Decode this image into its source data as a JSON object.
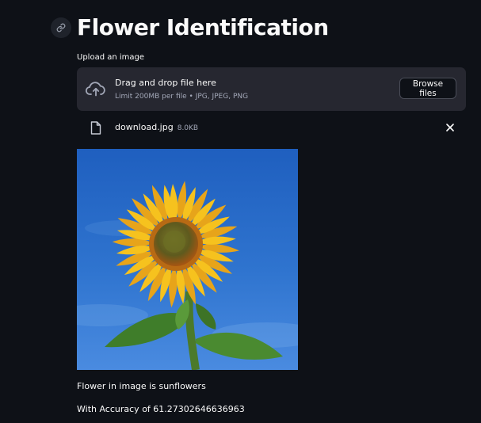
{
  "page": {
    "title": "Flower Identification",
    "anchor_icon": "link-icon"
  },
  "uploader": {
    "label": "Upload an image",
    "dropzone_title": "Drag and drop file here",
    "dropzone_subtitle": "Limit 200MB per file • JPG, JPEG, PNG",
    "dropzone_icon": "cloud-upload-icon",
    "browse_label": "Browse files"
  },
  "uploaded_file": {
    "name": "download.jpg",
    "size": "8.0KB",
    "icon": "file-icon",
    "remove_icon": "close-icon"
  },
  "results": {
    "prediction": "Flower in image is sunflowers",
    "accuracy": "With Accuracy of 61.27302646636963"
  },
  "colors": {
    "background": "#0e1117",
    "panel": "#262730",
    "text": "#fafafa",
    "muted_text": "#a3a8b8"
  }
}
